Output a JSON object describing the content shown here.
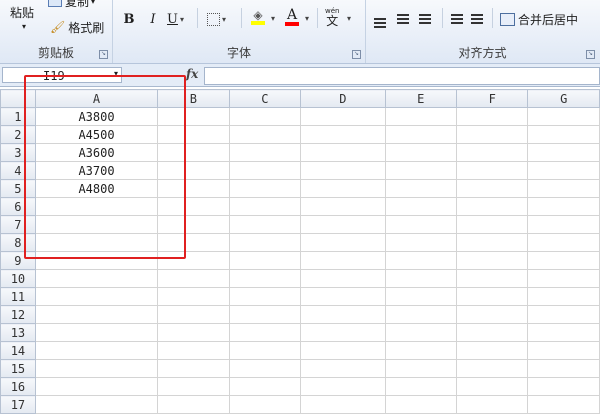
{
  "ribbon": {
    "clipboard": {
      "paste_label": "粘贴",
      "copy_label": "复制",
      "copy_arrow": "▾",
      "format_painter_label": "格式刷",
      "group_label": "剪贴板"
    },
    "font": {
      "bold": "B",
      "italic": "I",
      "underline": "U",
      "wen_label": "wén",
      "wen_char": "文",
      "font_color_letter": "A",
      "group_label": "字体"
    },
    "alignment": {
      "merge_label": "合并后居中",
      "group_label": "对齐方式"
    }
  },
  "formula_bar": {
    "name_box": "I19",
    "fx": "fx",
    "formula": ""
  },
  "sheet": {
    "columns": [
      "A",
      "B",
      "C",
      "D",
      "E",
      "F",
      "G"
    ],
    "rows": [
      {
        "num": "1",
        "a": "A3800"
      },
      {
        "num": "2",
        "a": "A4500"
      },
      {
        "num": "3",
        "a": "A3600"
      },
      {
        "num": "4",
        "a": "A3700"
      },
      {
        "num": "5",
        "a": "A4800"
      },
      {
        "num": "6",
        "a": ""
      },
      {
        "num": "7",
        "a": ""
      },
      {
        "num": "8",
        "a": ""
      },
      {
        "num": "9",
        "a": ""
      },
      {
        "num": "10",
        "a": ""
      },
      {
        "num": "11",
        "a": ""
      },
      {
        "num": "12",
        "a": ""
      },
      {
        "num": "13",
        "a": ""
      },
      {
        "num": "14",
        "a": ""
      },
      {
        "num": "15",
        "a": ""
      },
      {
        "num": "16",
        "a": ""
      },
      {
        "num": "17",
        "a": ""
      }
    ]
  },
  "colors": {
    "highlight_box": "#e02020",
    "fill_swatch": "#ffff00",
    "font_swatch": "#ff0000"
  }
}
